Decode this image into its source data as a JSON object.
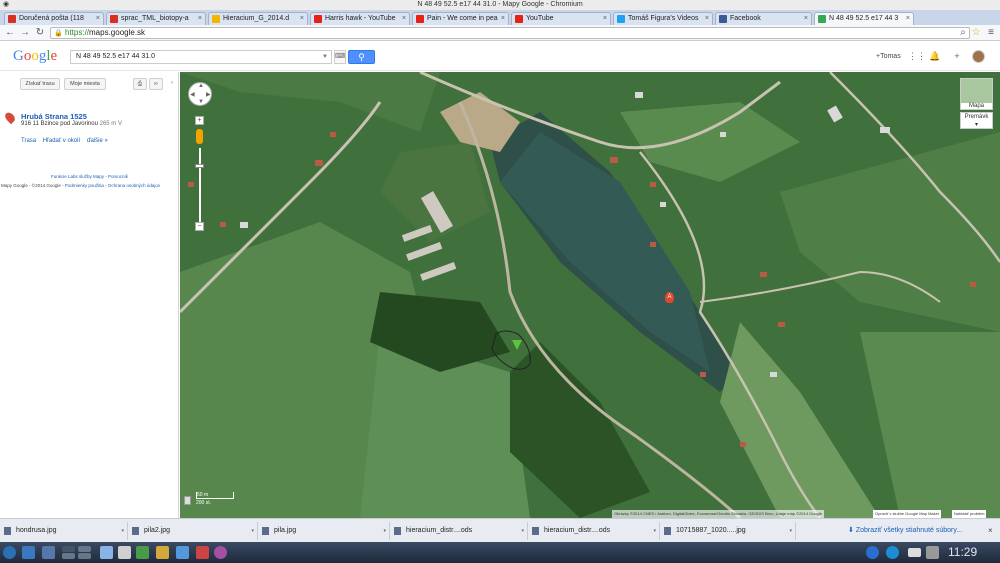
{
  "window": {
    "title": "N 48 49 52.5 e17 44 31.0 - Mapy Google - Chromium"
  },
  "tabs": [
    {
      "label": "Doručená pošta (118",
      "icon": "gmail-icon",
      "color": "#d93025"
    },
    {
      "label": "sprac_TML_biotopy-a",
      "icon": "gmail-icon",
      "color": "#d93025"
    },
    {
      "label": "Hieracium_G_2014.d",
      "icon": "doc-icon",
      "color": "#f4b400"
    },
    {
      "label": "Harris hawk - YouTube",
      "icon": "youtube-icon",
      "color": "#e62117"
    },
    {
      "label": "Pain - We come in pea",
      "icon": "youtube-icon",
      "color": "#e62117"
    },
    {
      "label": "YouTube",
      "icon": "youtube-icon",
      "color": "#e62117"
    },
    {
      "label": "Tomáš Figura's Videos",
      "icon": "twitter-icon",
      "color": "#1da1f2"
    },
    {
      "label": "Facebook",
      "icon": "facebook-icon",
      "color": "#3b5998"
    },
    {
      "label": "N 48 49 52.5 e17 44 3",
      "icon": "maps-icon",
      "color": "#34a853"
    }
  ],
  "toolbar": {
    "url_scheme": "https://",
    "url_rest": "maps.google.sk"
  },
  "header": {
    "logo": "Google",
    "search_value": "N 48 49 52.5 e17 44 31.0",
    "user": "+Tomas"
  },
  "left": {
    "directions_btn": "Získať trasu",
    "myplaces_btn": "Moje miesta",
    "place_title": "Hrubá Strana 1525",
    "place_address": "916 11 Bzince pod Javorinou",
    "place_distance": "265 m V",
    "link_route": "Trasa",
    "link_nearby": "Hľadať v okolí",
    "link_more": "ďalšie »",
    "labs_line": "Funkcie Labs služby Mapy - Pomocník",
    "copyright_prefix": "Mapy Google - ©2014 Google - ",
    "copyright_links": "Podmienky použitia - Ochrana osobných údajov"
  },
  "map": {
    "type_label": "Mapa",
    "overlay_label": "Premávk",
    "scale_top": "50 m",
    "scale_bottom": "200 st.",
    "attribution": "Obrázky ©2014 CNES / Astrium, DigitalGlobe, Eurosense/Geodis Slovakia, GEODIS Brno, Údaje máp ©2014 Google",
    "mapmaker": "Opraviť v službe Google Map Maker",
    "report": "Nahlásiť problém",
    "marker_letter": "A"
  },
  "downloads": {
    "items": [
      "hondrusa.jpg",
      "pila2.jpg",
      "pila.jpg",
      "hieracium_distr....ods",
      "hieracium_distr....ods",
      "10715887_1020.....jpg"
    ],
    "show_all": "Zobraziť všetky stiahnuté súbory..."
  },
  "taskbar": {
    "clock": "11:29"
  }
}
